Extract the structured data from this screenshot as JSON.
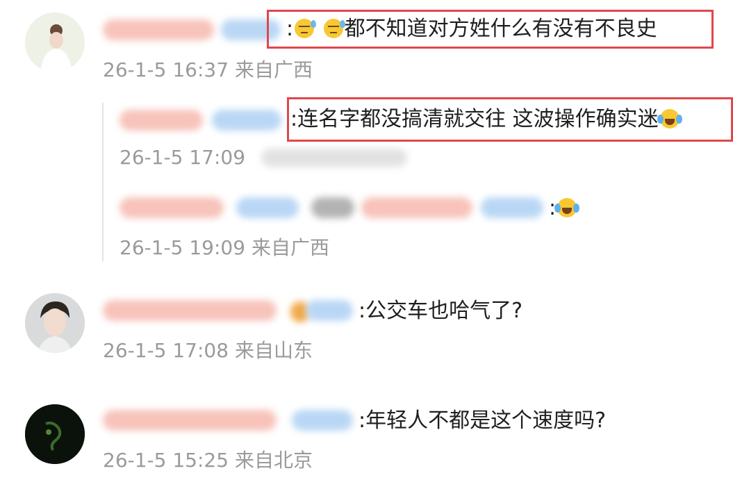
{
  "comments": [
    {
      "text": ":😓 😓都不知道对方姓什么有没有不良史",
      "time": "26-1-5 16:37 来自广西",
      "replies": [
        {
          "text": ":连名字都没搞清就交往 这波操作确实迷",
          "time": "26-1-5 17:09"
        },
        {
          "text": ":",
          "time": "26-1-5 19:09 来自广西"
        }
      ]
    },
    {
      "text": ":公交车也哈气了?",
      "time": "26-1-5 17:08 来自山东"
    },
    {
      "text": ":年轻人不都是这个速度吗?",
      "time": "26-1-5 15:25 来自北京"
    }
  ],
  "emoji": {
    "sweat": "sweat-emoji",
    "cry_laugh": "cry-laugh-emoji"
  },
  "highlight_color": "#e0474c"
}
